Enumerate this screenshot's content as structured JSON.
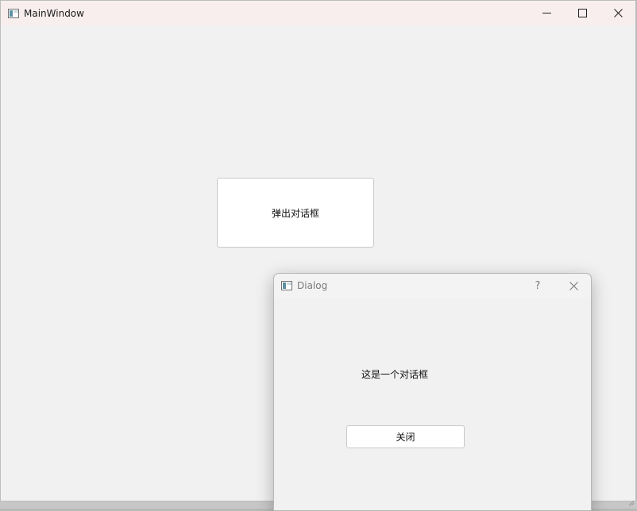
{
  "main_window": {
    "title": "MainWindow",
    "popup_button_label": "弹出对话框"
  },
  "dialog": {
    "title": "Dialog",
    "help_glyph": "?",
    "message": "这是一个对话框",
    "close_button_label": "关闭"
  },
  "icons": {
    "app": "app-window-icon",
    "minimize": "minimize-icon",
    "maximize": "maximize-icon",
    "close": "close-icon",
    "help": "help-icon"
  },
  "colors": {
    "main_titlebar": "#f8eeee",
    "window_bg": "#f1f1f1",
    "button_bg": "#ffffff",
    "dialog_title_text": "#7b7b7b"
  }
}
